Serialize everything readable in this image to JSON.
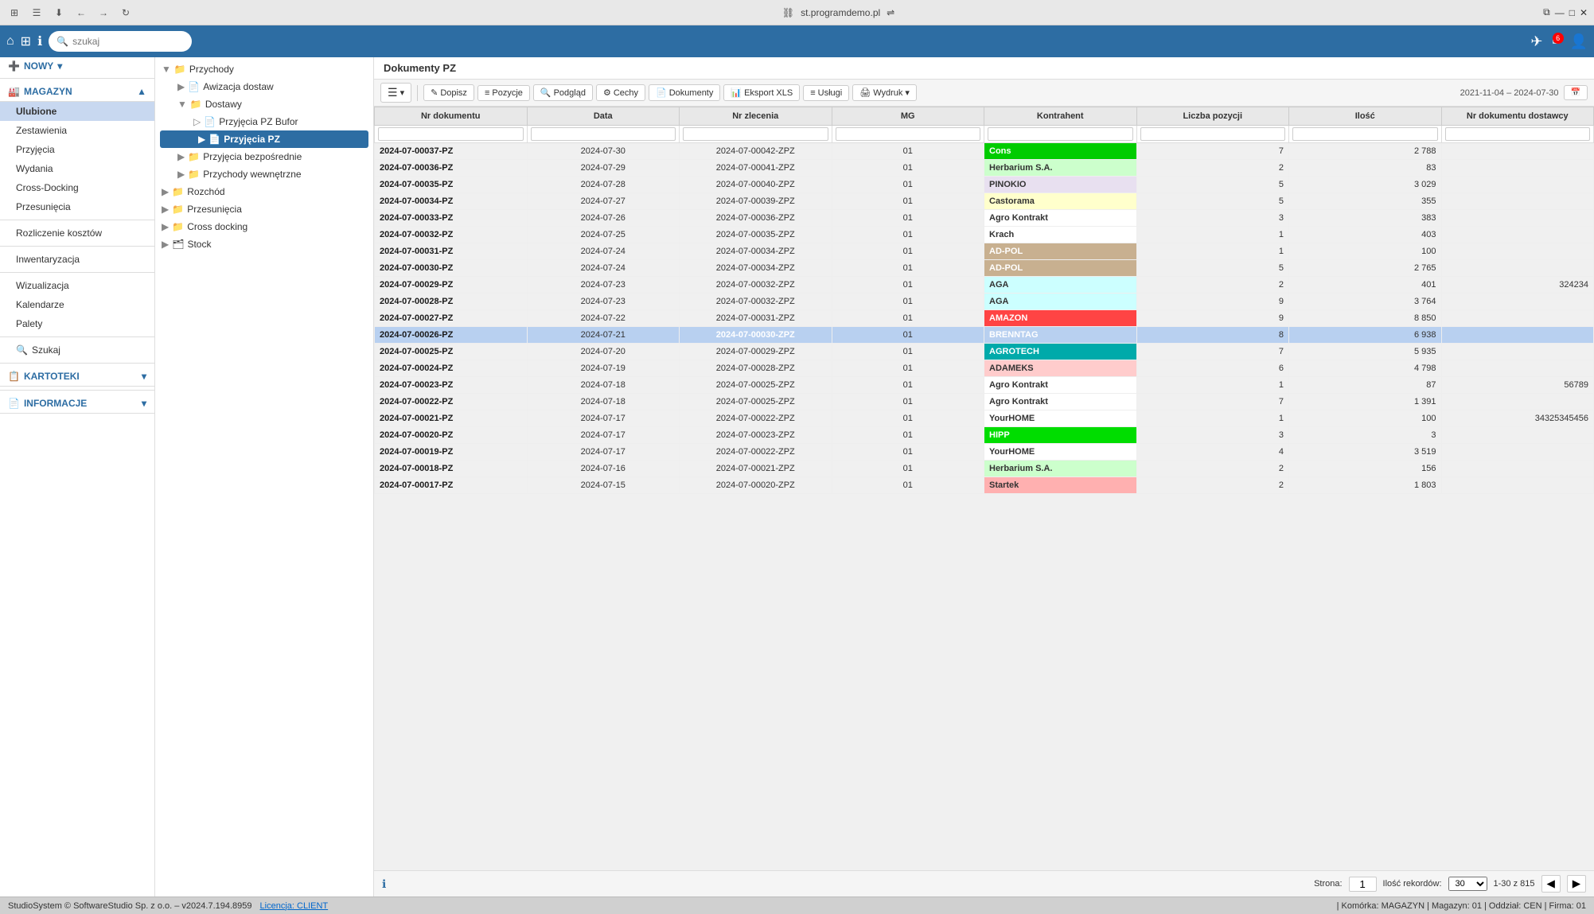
{
  "window": {
    "title": "st.programdemo.pl",
    "tab_icon": "⛓"
  },
  "topbar": {
    "back_tooltip": "Back",
    "forward_tooltip": "Forward",
    "reload_tooltip": "Reload",
    "url": "st.programdemo.pl"
  },
  "navbar": {
    "search_placeholder": "szukaj",
    "badge_count": "6",
    "nowy_label": "NOWY"
  },
  "sidebar": {
    "nowy": "NOWY",
    "magazyn": "MAGAZYN",
    "ulubione": "Ulubione",
    "zestawienia": "Zestawienia",
    "przyjecia": "Przyjęcia",
    "wydania": "Wydania",
    "cross_docking": "Cross-Docking",
    "przesunecia": "Przesunięcia",
    "rozliczenie_kosztow": "Rozliczenie kosztów",
    "inwentaryzacja": "Inwentaryzacja",
    "wizualizacja": "Wizualizacja",
    "kalendarze": "Kalendarze",
    "palety": "Palety",
    "szukaj": "Szukaj",
    "kartoteki": "KARTOTEKI",
    "informacje": "INFORMACJE",
    "tree": {
      "przychody": "Przychody",
      "awizacja_dostaw": "Awizacja dostaw",
      "dostawy": "Dostawy",
      "przyjecia_pz_bufor": "Przyjęcia PZ Bufor",
      "przyjecia_pz": "Przyjęcia PZ",
      "przyjecia_bezposrednie": "Przyjęcia bezpośrednie",
      "przychody_wewnetrzne": "Przychody wewnętrzne",
      "rozchod": "Rozchód",
      "przesunecia": "Przesunięcia",
      "cross_docking": "Cross docking",
      "stock": "Stock"
    }
  },
  "content": {
    "header": "Dokumenty PZ",
    "toolbar": {
      "menu_btn": "☰",
      "dopisz": "Dopisz",
      "pozycje": "Pozycje",
      "podglad": "Podgląd",
      "cechy": "Cechy",
      "dokumenty": "Dokumenty",
      "eksport_xls": "Eksport XLS",
      "uslugi": "Usługi",
      "wydruk": "Wydruk",
      "date_range": "2021-11-04 – 2024-07-30"
    },
    "table": {
      "columns": [
        "Nr dokumentu",
        "Data",
        "Nr zlecenia",
        "MG",
        "Kontrahent",
        "Liczba pozycji",
        "Ilość",
        "Nr dokumentu dostawcy"
      ],
      "rows": [
        {
          "nr_doc": "2024-07-00037-PZ",
          "data": "2024-07-30",
          "nr_zlecenia": "2024-07-00042-ZPZ",
          "mg": "01",
          "kontrahent": "Cons",
          "kontrahent_color": "k-green",
          "liczba_poz": "7",
          "ilosc": "2 788",
          "nr_doc_dostawcy": ""
        },
        {
          "nr_doc": "2024-07-00036-PZ",
          "data": "2024-07-29",
          "nr_zlecenia": "2024-07-00041-ZPZ",
          "mg": "01",
          "kontrahent": "Herbarium S.A.",
          "kontrahent_color": "k-lightgreen",
          "liczba_poz": "2",
          "ilosc": "83",
          "nr_doc_dostawcy": ""
        },
        {
          "nr_doc": "2024-07-00035-PZ",
          "data": "2024-07-28",
          "nr_zlecenia": "2024-07-00040-ZPZ",
          "mg": "01",
          "kontrahent": "PINOKIO",
          "kontrahent_color": "k-lavender",
          "liczba_poz": "5",
          "ilosc": "3 029",
          "nr_doc_dostawcy": ""
        },
        {
          "nr_doc": "2024-07-00034-PZ",
          "data": "2024-07-27",
          "nr_zlecenia": "2024-07-00039-ZPZ",
          "mg": "01",
          "kontrahent": "Castorama",
          "kontrahent_color": "k-yellow",
          "liczba_poz": "5",
          "ilosc": "355",
          "nr_doc_dostawcy": ""
        },
        {
          "nr_doc": "2024-07-00033-PZ",
          "data": "2024-07-26",
          "nr_zlecenia": "2024-07-00036-ZPZ",
          "mg": "01",
          "kontrahent": "Agro Kontrakt",
          "kontrahent_color": "k-white",
          "liczba_poz": "3",
          "ilosc": "383",
          "nr_doc_dostawcy": ""
        },
        {
          "nr_doc": "2024-07-00032-PZ",
          "data": "2024-07-25",
          "nr_zlecenia": "2024-07-00035-ZPZ",
          "mg": "01",
          "kontrahent": "Krach",
          "kontrahent_color": "k-white",
          "liczba_poz": "1",
          "ilosc": "403",
          "nr_doc_dostawcy": ""
        },
        {
          "nr_doc": "2024-07-00031-PZ",
          "data": "2024-07-24",
          "nr_zlecenia": "2024-07-00034-ZPZ",
          "mg": "01",
          "kontrahent": "AD-POL",
          "kontrahent_color": "k-tan",
          "liczba_poz": "1",
          "ilosc": "100",
          "nr_doc_dostawcy": ""
        },
        {
          "nr_doc": "2024-07-00030-PZ",
          "data": "2024-07-24",
          "nr_zlecenia": "2024-07-00034-ZPZ",
          "mg": "01",
          "kontrahent": "AD-POL",
          "kontrahent_color": "k-tan",
          "liczba_poz": "5",
          "ilosc": "2 765",
          "nr_doc_dostawcy": ""
        },
        {
          "nr_doc": "2024-07-00029-PZ",
          "data": "2024-07-23",
          "nr_zlecenia": "2024-07-00032-ZPZ",
          "mg": "01",
          "kontrahent": "AGA",
          "kontrahent_color": "k-cyan",
          "liczba_poz": "2",
          "ilosc": "401",
          "nr_doc_dostawcy": "324234"
        },
        {
          "nr_doc": "2024-07-00028-PZ",
          "data": "2024-07-23",
          "nr_zlecenia": "2024-07-00032-ZPZ",
          "mg": "01",
          "kontrahent": "AGA",
          "kontrahent_color": "k-cyan",
          "liczba_poz": "9",
          "ilosc": "3 764",
          "nr_doc_dostawcy": ""
        },
        {
          "nr_doc": "2024-07-00027-PZ",
          "data": "2024-07-22",
          "nr_zlecenia": "2024-07-00031-ZPZ",
          "mg": "01",
          "kontrahent": "AMAZON",
          "kontrahent_color": "k-red",
          "liczba_poz": "9",
          "ilosc": "8 850",
          "nr_doc_dostawcy": ""
        },
        {
          "nr_doc": "2024-07-00026-PZ",
          "data": "2024-07-21",
          "nr_zlecenia": "2024-07-00030-ZPZ",
          "mg": "01",
          "kontrahent": "BRENNTAG",
          "kontrahent_color": "k-darkblue",
          "liczba_poz": "8",
          "ilosc": "6 938",
          "nr_doc_dostawcy": "",
          "selected": true
        },
        {
          "nr_doc": "2024-07-00025-PZ",
          "data": "2024-07-20",
          "nr_zlecenia": "2024-07-00029-ZPZ",
          "mg": "01",
          "kontrahent": "AGROTECH",
          "kontrahent_color": "k-teal",
          "liczba_poz": "7",
          "ilosc": "5 935",
          "nr_doc_dostawcy": ""
        },
        {
          "nr_doc": "2024-07-00024-PZ",
          "data": "2024-07-19",
          "nr_zlecenia": "2024-07-00028-ZPZ",
          "mg": "01",
          "kontrahent": "ADAMEKS",
          "kontrahent_color": "k-pink",
          "liczba_poz": "6",
          "ilosc": "4 798",
          "nr_doc_dostawcy": ""
        },
        {
          "nr_doc": "2024-07-00023-PZ",
          "data": "2024-07-18",
          "nr_zlecenia": "2024-07-00025-ZPZ",
          "mg": "01",
          "kontrahent": "Agro Kontrakt",
          "kontrahent_color": "k-white",
          "liczba_poz": "1",
          "ilosc": "87",
          "nr_doc_dostawcy": "56789"
        },
        {
          "nr_doc": "2024-07-00022-PZ",
          "data": "2024-07-18",
          "nr_zlecenia": "2024-07-00025-ZPZ",
          "mg": "01",
          "kontrahent": "Agro Kontrakt",
          "kontrahent_color": "k-white",
          "liczba_poz": "7",
          "ilosc": "1 391",
          "nr_doc_dostawcy": ""
        },
        {
          "nr_doc": "2024-07-00021-PZ",
          "data": "2024-07-17",
          "nr_zlecenia": "2024-07-00022-ZPZ",
          "mg": "01",
          "kontrahent": "YourHOME",
          "kontrahent_color": "k-white",
          "liczba_poz": "1",
          "ilosc": "100",
          "nr_doc_dostawcy": "34325345456"
        },
        {
          "nr_doc": "2024-07-00020-PZ",
          "data": "2024-07-17",
          "nr_zlecenia": "2024-07-00023-ZPZ",
          "mg": "01",
          "kontrahent": "HIPP",
          "kontrahent_color": "k-brightgreen",
          "liczba_poz": "3",
          "ilosc": "3",
          "nr_doc_dostawcy": ""
        },
        {
          "nr_doc": "2024-07-00019-PZ",
          "data": "2024-07-17",
          "nr_zlecenia": "2024-07-00022-ZPZ",
          "mg": "01",
          "kontrahent": "YourHOME",
          "kontrahent_color": "k-white",
          "liczba_poz": "4",
          "ilosc": "3 519",
          "nr_doc_dostawcy": ""
        },
        {
          "nr_doc": "2024-07-00018-PZ",
          "data": "2024-07-16",
          "nr_zlecenia": "2024-07-00021-ZPZ",
          "mg": "01",
          "kontrahent": "Herbarium S.A.",
          "kontrahent_color": "k-lightgreen",
          "liczba_poz": "2",
          "ilosc": "156",
          "nr_doc_dostawcy": ""
        },
        {
          "nr_doc": "2024-07-00017-PZ",
          "data": "2024-07-15",
          "nr_zlecenia": "2024-07-00020-ZPZ",
          "mg": "01",
          "kontrahent": "Startek",
          "kontrahent_color": "k-salmon",
          "liczba_poz": "2",
          "ilosc": "1 803",
          "nr_doc_dostawcy": ""
        }
      ]
    },
    "pagination": {
      "strona_label": "Strona:",
      "strona_value": "1",
      "ilosc_rekordow_label": "Ilość rekordów:",
      "ilosc_value": "30",
      "range": "1-30 z 815"
    },
    "info_icon": "ℹ"
  },
  "statusbar": {
    "copyright": "StudioSystem © SoftwareStudio Sp. z o.o. – v2024.7.194.8959",
    "license": "Licencja: CLIENT",
    "right": "| Komórka: MAGAZYN | Magazyn: 01 | Oddział: CEN | Firma: 01"
  }
}
